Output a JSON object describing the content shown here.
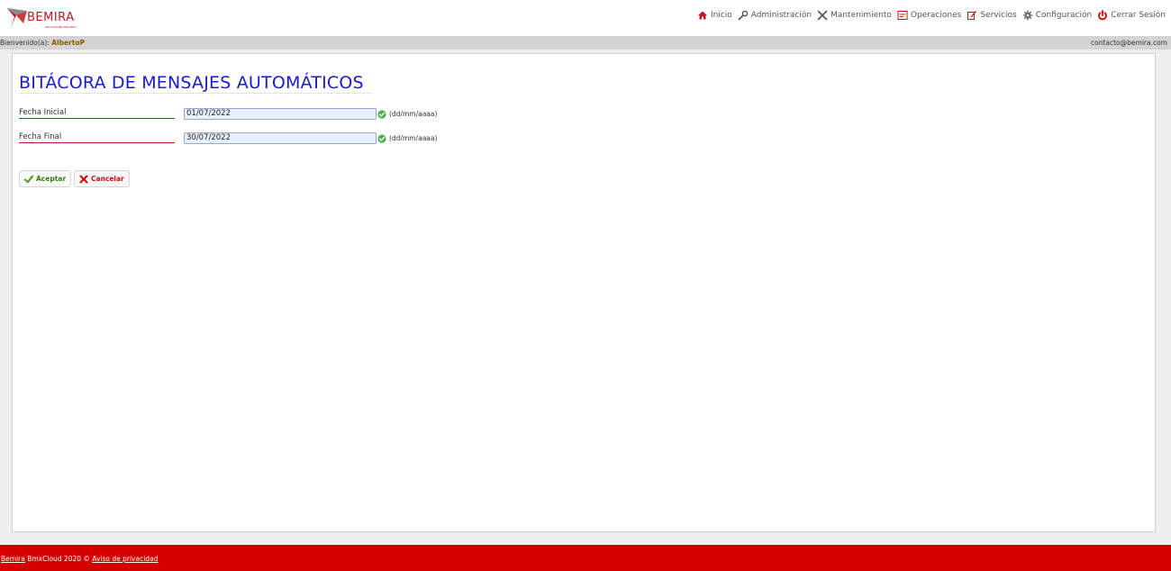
{
  "brand": {
    "name": "BEMIRA",
    "tagline": "SOLUCIONES SEGURAS",
    "color": "#c4161c"
  },
  "nav": {
    "items": [
      {
        "label": "Inicio",
        "icon": "home-icon"
      },
      {
        "label": "Administración",
        "icon": "wrench-icon"
      },
      {
        "label": "Mantenimiento",
        "icon": "tools-icon"
      },
      {
        "label": "Operaciones",
        "icon": "ops-icon"
      },
      {
        "label": "Servicios",
        "icon": "services-icon"
      },
      {
        "label": "Configuración",
        "icon": "gear-icon"
      },
      {
        "label": "Cerrar Sesión",
        "icon": "power-icon"
      }
    ]
  },
  "welcome": {
    "prefix": "Bienvenido(a): ",
    "user": "AlbertoP",
    "contact": "contacto@bemira.com"
  },
  "page": {
    "title": "BITÁCORA DE MENSAJES AUTOMÁTICOS"
  },
  "form": {
    "fecha_inicial": {
      "label": "Fecha Inicial",
      "value": "01/07/2022",
      "hint": "(dd/mm/aaaa)"
    },
    "fecha_final": {
      "label": "Fecha Final",
      "value": "30/07/2022",
      "hint": "(dd/mm/aaaa)"
    }
  },
  "buttons": {
    "accept": "Aceptar",
    "cancel": "Cancelar"
  },
  "footer": {
    "brand_link": "Bemira",
    "text": " BmxCloud 2020 © ",
    "privacy_link": "Aviso de privacidad"
  },
  "colors": {
    "accent_red": "#d40000",
    "title_blue": "#1a1ad6",
    "ok_green": "#4caf50"
  }
}
